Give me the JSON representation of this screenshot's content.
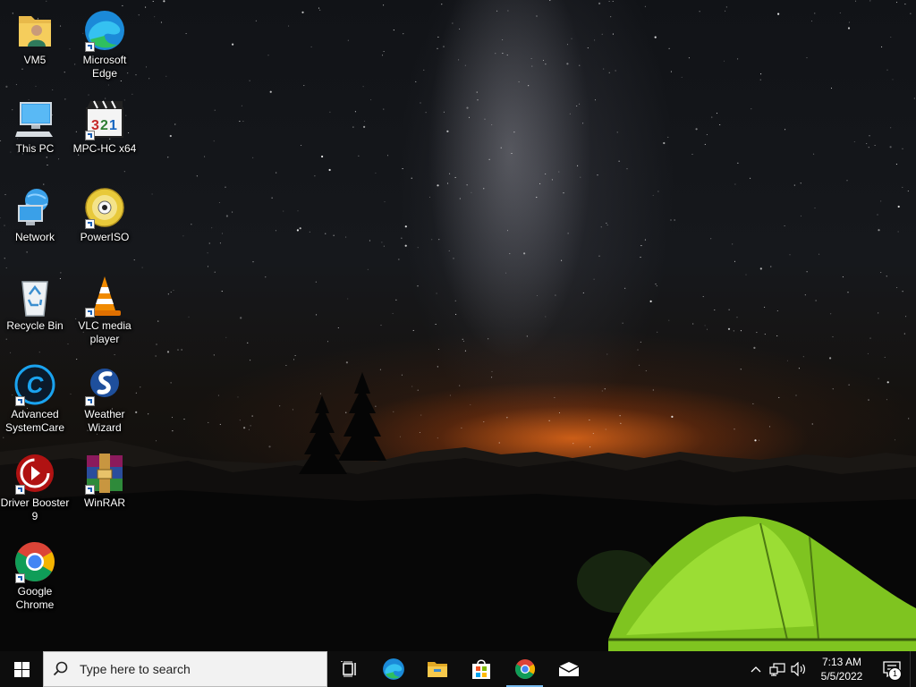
{
  "desktop": {
    "wallpaper": "night-sky-tent",
    "icons": [
      {
        "id": "vm5",
        "label": "VM5",
        "icon": "user-folder-icon"
      },
      {
        "id": "edge",
        "label": "Microsoft Edge",
        "icon": "edge-icon",
        "shortcut": true
      },
      {
        "id": "this-pc",
        "label": "This PC",
        "icon": "computer-icon"
      },
      {
        "id": "mpc",
        "label": "MPC-HC x64",
        "icon": "mpc-hc-icon",
        "shortcut": true
      },
      {
        "id": "network",
        "label": "Network",
        "icon": "network-icon"
      },
      {
        "id": "poweriso",
        "label": "PowerISO",
        "icon": "poweriso-disc-icon",
        "shortcut": true
      },
      {
        "id": "recycle",
        "label": "Recycle Bin",
        "icon": "recycle-bin-icon"
      },
      {
        "id": "vlc",
        "label": "VLC media player",
        "icon": "vlc-cone-icon",
        "shortcut": true
      },
      {
        "id": "asc",
        "label": "Advanced SystemCare",
        "icon": "advanced-systemcare-icon",
        "shortcut": true
      },
      {
        "id": "weather",
        "label": "Weather Wizard",
        "icon": "weather-wizard-icon",
        "shortcut": true
      },
      {
        "id": "driver",
        "label": "Driver Booster 9",
        "icon": "driver-booster-icon",
        "shortcut": true
      },
      {
        "id": "winrar",
        "label": "WinRAR",
        "icon": "winrar-icon",
        "shortcut": true
      },
      {
        "id": "chrome",
        "label": "Google Chrome",
        "icon": "chrome-icon",
        "shortcut": true
      }
    ]
  },
  "taskbar": {
    "search_placeholder": "Type here to search",
    "pinned": [
      {
        "name": "Task View",
        "icon": "task-view-icon"
      },
      {
        "name": "Microsoft Edge",
        "icon": "edge-icon"
      },
      {
        "name": "File Explorer",
        "icon": "file-explorer-icon"
      },
      {
        "name": "Microsoft Store",
        "icon": "store-icon"
      },
      {
        "name": "Google Chrome",
        "icon": "chrome-icon",
        "active": true
      },
      {
        "name": "Mail",
        "icon": "mail-icon"
      }
    ],
    "tray": {
      "time": "7:13 AM",
      "date": "5/5/2022",
      "notification_count": "1"
    }
  },
  "colors": {
    "taskbar_bg": "#0d0d0d",
    "accent_active": "#76b9ed",
    "tent_green": "#8fd62a",
    "horizon_glow": "#e66a19"
  }
}
